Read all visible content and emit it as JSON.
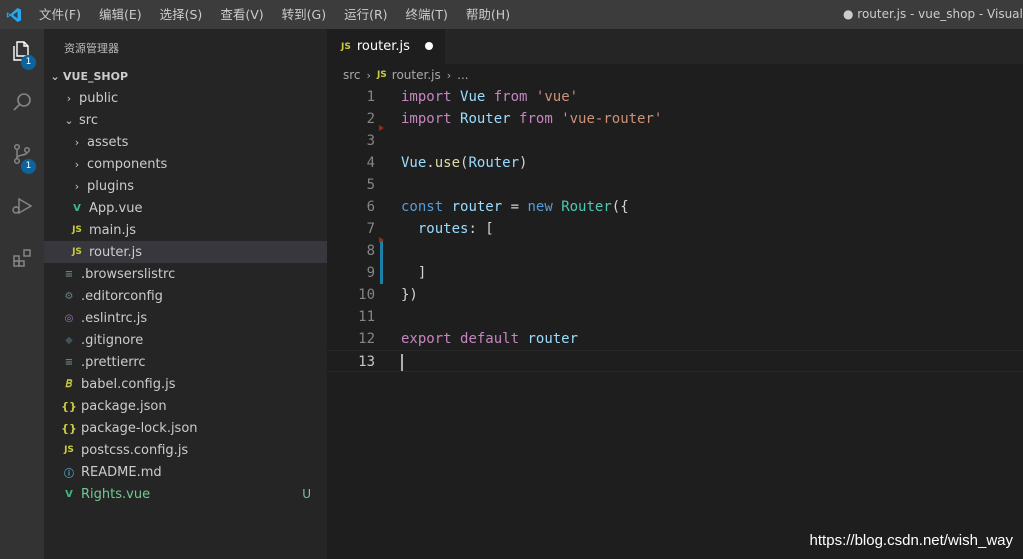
{
  "titlebar": {
    "menu": [
      "文件(F)",
      "编辑(E)",
      "选择(S)",
      "查看(V)",
      "转到(G)",
      "运行(R)",
      "终端(T)",
      "帮助(H)"
    ],
    "window_title": "● router.js - vue_shop - Visual Stu"
  },
  "activity": {
    "explorer_badge": "1",
    "scm_badge": "1"
  },
  "sidebar": {
    "title": "资源管理器",
    "section": "VUE_SHOP",
    "items": [
      {
        "label": "public",
        "kind": "folder",
        "depth": 1,
        "expanded": false
      },
      {
        "label": "src",
        "kind": "folder",
        "depth": 1,
        "expanded": true
      },
      {
        "label": "assets",
        "kind": "folder",
        "depth": 2,
        "expanded": false
      },
      {
        "label": "components",
        "kind": "folder",
        "depth": 2,
        "expanded": false
      },
      {
        "label": "plugins",
        "kind": "folder",
        "depth": 2,
        "expanded": false
      },
      {
        "label": "App.vue",
        "kind": "vue",
        "depth": 2
      },
      {
        "label": "main.js",
        "kind": "js",
        "depth": 2
      },
      {
        "label": "router.js",
        "kind": "js",
        "depth": 2,
        "selected": true
      },
      {
        "label": ".browserslistrc",
        "kind": "text",
        "depth": 1
      },
      {
        "label": ".editorconfig",
        "kind": "gear",
        "depth": 1
      },
      {
        "label": ".eslintrc.js",
        "kind": "eslint",
        "depth": 1
      },
      {
        "label": ".gitignore",
        "kind": "git",
        "depth": 1
      },
      {
        "label": ".prettierrc",
        "kind": "text",
        "depth": 1
      },
      {
        "label": "babel.config.js",
        "kind": "babel",
        "depth": 1
      },
      {
        "label": "package.json",
        "kind": "json",
        "depth": 1
      },
      {
        "label": "package-lock.json",
        "kind": "json",
        "depth": 1
      },
      {
        "label": "postcss.config.js",
        "kind": "js",
        "depth": 1
      },
      {
        "label": "README.md",
        "kind": "info",
        "depth": 1
      },
      {
        "label": "Rights.vue",
        "kind": "vue",
        "depth": 1,
        "git_status": "U"
      }
    ]
  },
  "tab": {
    "label": "router.js",
    "js_tag": "JS"
  },
  "breadcrumb": {
    "folder": "src",
    "file": "router.js",
    "more": "..."
  },
  "editor": {
    "active_line": 13,
    "lines": [
      [
        {
          "t": "import",
          "c": "kw"
        },
        {
          "t": " ",
          "c": "pn"
        },
        {
          "t": "Vue",
          "c": "id"
        },
        {
          "t": " ",
          "c": "pn"
        },
        {
          "t": "from",
          "c": "kw"
        },
        {
          "t": " ",
          "c": "pn"
        },
        {
          "t": "'vue'",
          "c": "str"
        }
      ],
      [
        {
          "t": "import",
          "c": "kw"
        },
        {
          "t": " ",
          "c": "pn"
        },
        {
          "t": "Router",
          "c": "id"
        },
        {
          "t": " ",
          "c": "pn"
        },
        {
          "t": "from",
          "c": "kw"
        },
        {
          "t": " ",
          "c": "pn"
        },
        {
          "t": "'vue-router'",
          "c": "str"
        }
      ],
      [],
      [
        {
          "t": "Vue",
          "c": "id"
        },
        {
          "t": ".",
          "c": "pn"
        },
        {
          "t": "use",
          "c": "fn"
        },
        {
          "t": "(",
          "c": "pn"
        },
        {
          "t": "Router",
          "c": "id"
        },
        {
          "t": ")",
          "c": "pn"
        }
      ],
      [],
      [
        {
          "t": "const",
          "c": "kwb"
        },
        {
          "t": " ",
          "c": "pn"
        },
        {
          "t": "router",
          "c": "id"
        },
        {
          "t": " = ",
          "c": "pn"
        },
        {
          "t": "new",
          "c": "kwb"
        },
        {
          "t": " ",
          "c": "pn"
        },
        {
          "t": "Router",
          "c": "cls"
        },
        {
          "t": "({",
          "c": "pn"
        }
      ],
      [
        {
          "t": "  ",
          "c": "pn"
        },
        {
          "t": "routes",
          "c": "id"
        },
        {
          "t": ": [",
          "c": "pn"
        }
      ],
      [],
      [
        {
          "t": "  ]",
          "c": "pn"
        }
      ],
      [
        {
          "t": "})",
          "c": "pn"
        }
      ],
      [],
      [
        {
          "t": "export",
          "c": "kw"
        },
        {
          "t": " ",
          "c": "pn"
        },
        {
          "t": "default",
          "c": "kw"
        },
        {
          "t": " ",
          "c": "pn"
        },
        {
          "t": "router",
          "c": "id"
        }
      ],
      []
    ]
  },
  "watermark": "https://blog.csdn.net/wish_way"
}
